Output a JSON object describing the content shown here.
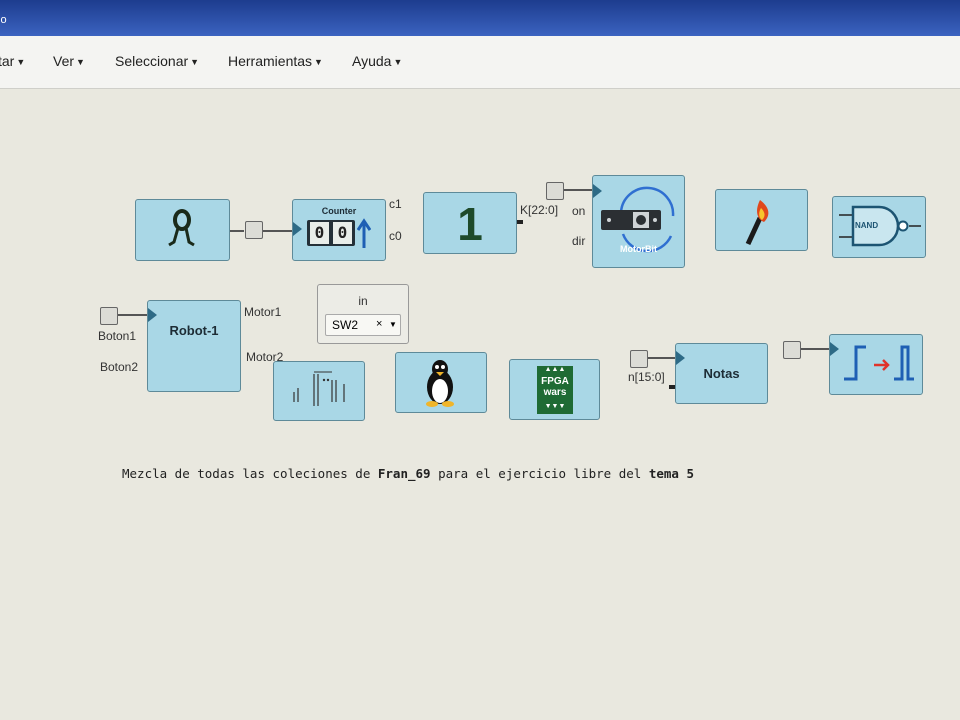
{
  "window": {
    "title_fragment": "io"
  },
  "menubar": {
    "items": [
      {
        "label": "tar"
      },
      {
        "label": "Ver"
      },
      {
        "label": "Seleccionar"
      },
      {
        "label": "Herramientas"
      },
      {
        "label": "Ayuda"
      }
    ]
  },
  "blocks": {
    "counter": {
      "title": "Counter",
      "digits": [
        "0",
        "0"
      ],
      "outputs": [
        "c1",
        "c0"
      ]
    },
    "constant": {
      "value": "1",
      "output_label": "K[22:0]"
    },
    "motorbit": {
      "title": "MotorBit",
      "inputs": [
        "on",
        "dir"
      ]
    },
    "nand": {
      "title": "NAND"
    },
    "robot": {
      "title": "Robot-1",
      "inputs": [
        "Boton1",
        "Boton2"
      ],
      "outputs": [
        "Motor1",
        "Motor2"
      ]
    },
    "input_pin": {
      "label": "in",
      "value": "SW2",
      "clear": "×"
    },
    "fpga": {
      "line1": "FPGA",
      "line2": "wars"
    },
    "notas": {
      "title": "Notas",
      "input_label": "n[15:0]"
    }
  },
  "description": {
    "part1": "Mezcla de todas las coleciones de ",
    "bold1": "Fran_69",
    "part2": " para el ejercicio libre del ",
    "bold2": "tema 5"
  },
  "colors": {
    "block_fill": "#a9d7e6",
    "block_border": "#5e8a99",
    "background": "#e9e8df",
    "titlebar": "#2b4fa8"
  }
}
